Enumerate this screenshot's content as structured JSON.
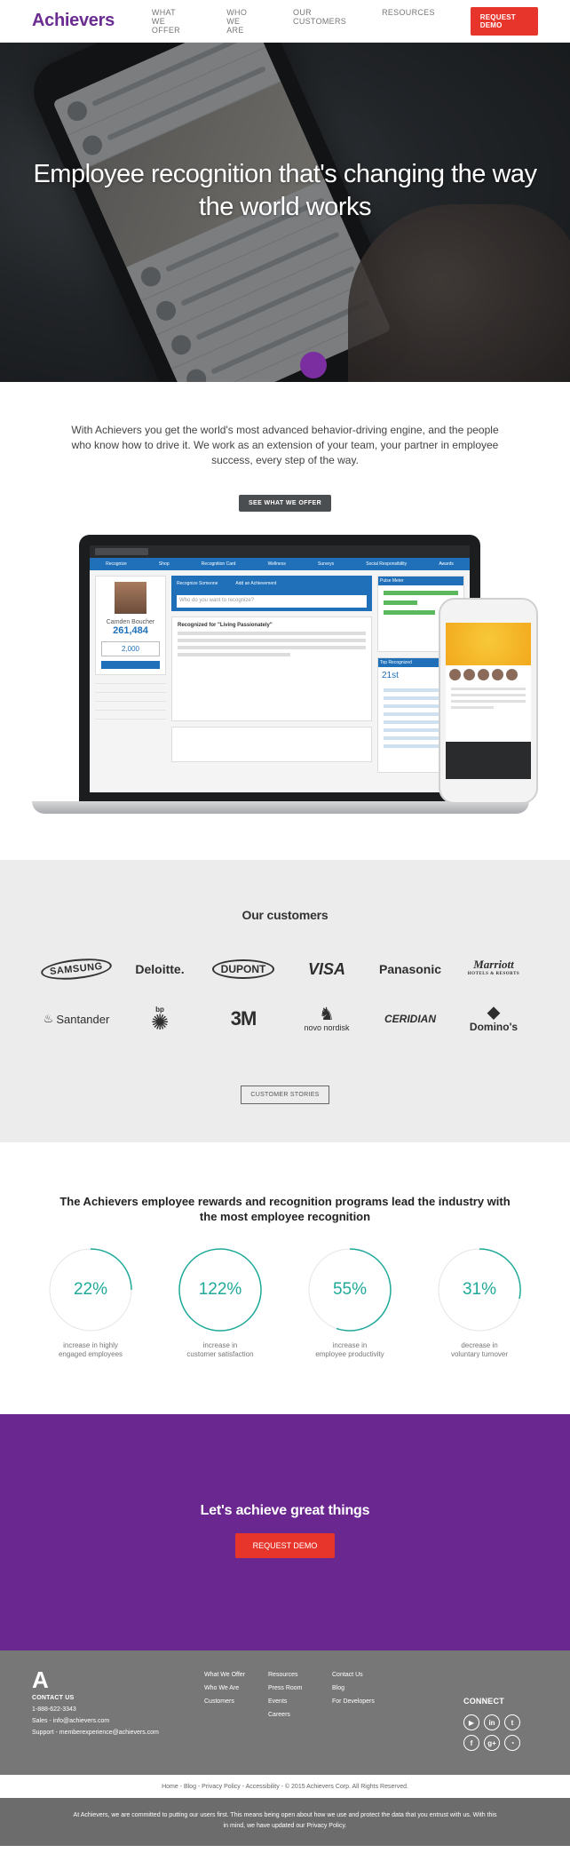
{
  "nav": {
    "logo": "Achievers",
    "links": [
      "WHAT WE OFFER",
      "WHO WE ARE",
      "OUR CUSTOMERS",
      "RESOURCES"
    ],
    "cta": "REQUEST DEMO"
  },
  "hero": {
    "title": "Employee recognition that's changing the way the world works"
  },
  "intro": {
    "text": "With Achievers you get the world's most advanced behavior-driving engine, and the people who know how to drive it. We work as an extension of your team, your partner in employee success, every step of the way.",
    "button": "SEE WHAT WE OFFER"
  },
  "app": {
    "tabs": [
      "Recognize",
      "Shop",
      "Recognition Card",
      "Wellness",
      "Surveys",
      "Social Responsibility",
      "Awards"
    ],
    "profile_name": "Camden Boucher",
    "profile_points": "261,484",
    "points_to_award": "2,000",
    "recognize_label": "Recognize Someone",
    "achievement_label": "Add an Achievement",
    "input_placeholder": "Who do you want to recognize?",
    "card_title": "Recognized for \"Living Passionately\"",
    "pulse_title": "Pulse Meter",
    "top_title": "Top Recognized",
    "top_number": "21st"
  },
  "customers": {
    "title": "Our customers",
    "logos": [
      "SAMSUNG",
      "Deloitte.",
      "DUPONT",
      "VISA",
      "Panasonic",
      "Marriott",
      "Santander",
      "bp",
      "3M",
      "novo nordisk",
      "CERIDIAN",
      "Domino's"
    ],
    "marriott_sub": "HOTELS & RESORTS",
    "button": "CUSTOMER STORIES"
  },
  "stats": {
    "title": "The Achievers employee rewards and recognition programs lead the industry with the most employee recognition",
    "items": [
      {
        "value": "22%",
        "label1": "increase in highly",
        "label2": "engaged employees"
      },
      {
        "value": "122%",
        "label1": "increase in",
        "label2": "customer satisfaction"
      },
      {
        "value": "55%",
        "label1": "increase in",
        "label2": "employee productivity"
      },
      {
        "value": "31%",
        "label1": "decrease in",
        "label2": "voluntary turnover"
      }
    ],
    "accent": "#1fa99a"
  },
  "cta": {
    "title": "Let's achieve great things",
    "button": "REQUEST DEMO",
    "bg": "#6a2790"
  },
  "footer": {
    "contact_heading": "CONTACT US",
    "phone": "1-888-622-3343",
    "sales": "Sales - info@achievers.com",
    "support": "Support - memberexperience@achievers.com",
    "col1": [
      "What We Offer",
      "Who We Are",
      "Customers"
    ],
    "col2": [
      "Resources",
      "Press Room",
      "Events",
      "Careers"
    ],
    "col3": [
      "Contact Us",
      "Blog",
      "For Developers"
    ],
    "connect_heading": "CONNECT",
    "social": [
      "youtube-icon",
      "linkedin-icon",
      "twitter-icon",
      "facebook-icon",
      "google-plus-icon",
      "rss-icon"
    ],
    "legal": "Home - Blog - Privacy Policy - Accessibility - © 2015 Achievers Corp. All Rights Reserved.",
    "privacy": "At Achievers, we are committed to putting our users first. This means being open about how we use and protect the data that you entrust with us. With this in mind, we have updated our Privacy Policy."
  }
}
